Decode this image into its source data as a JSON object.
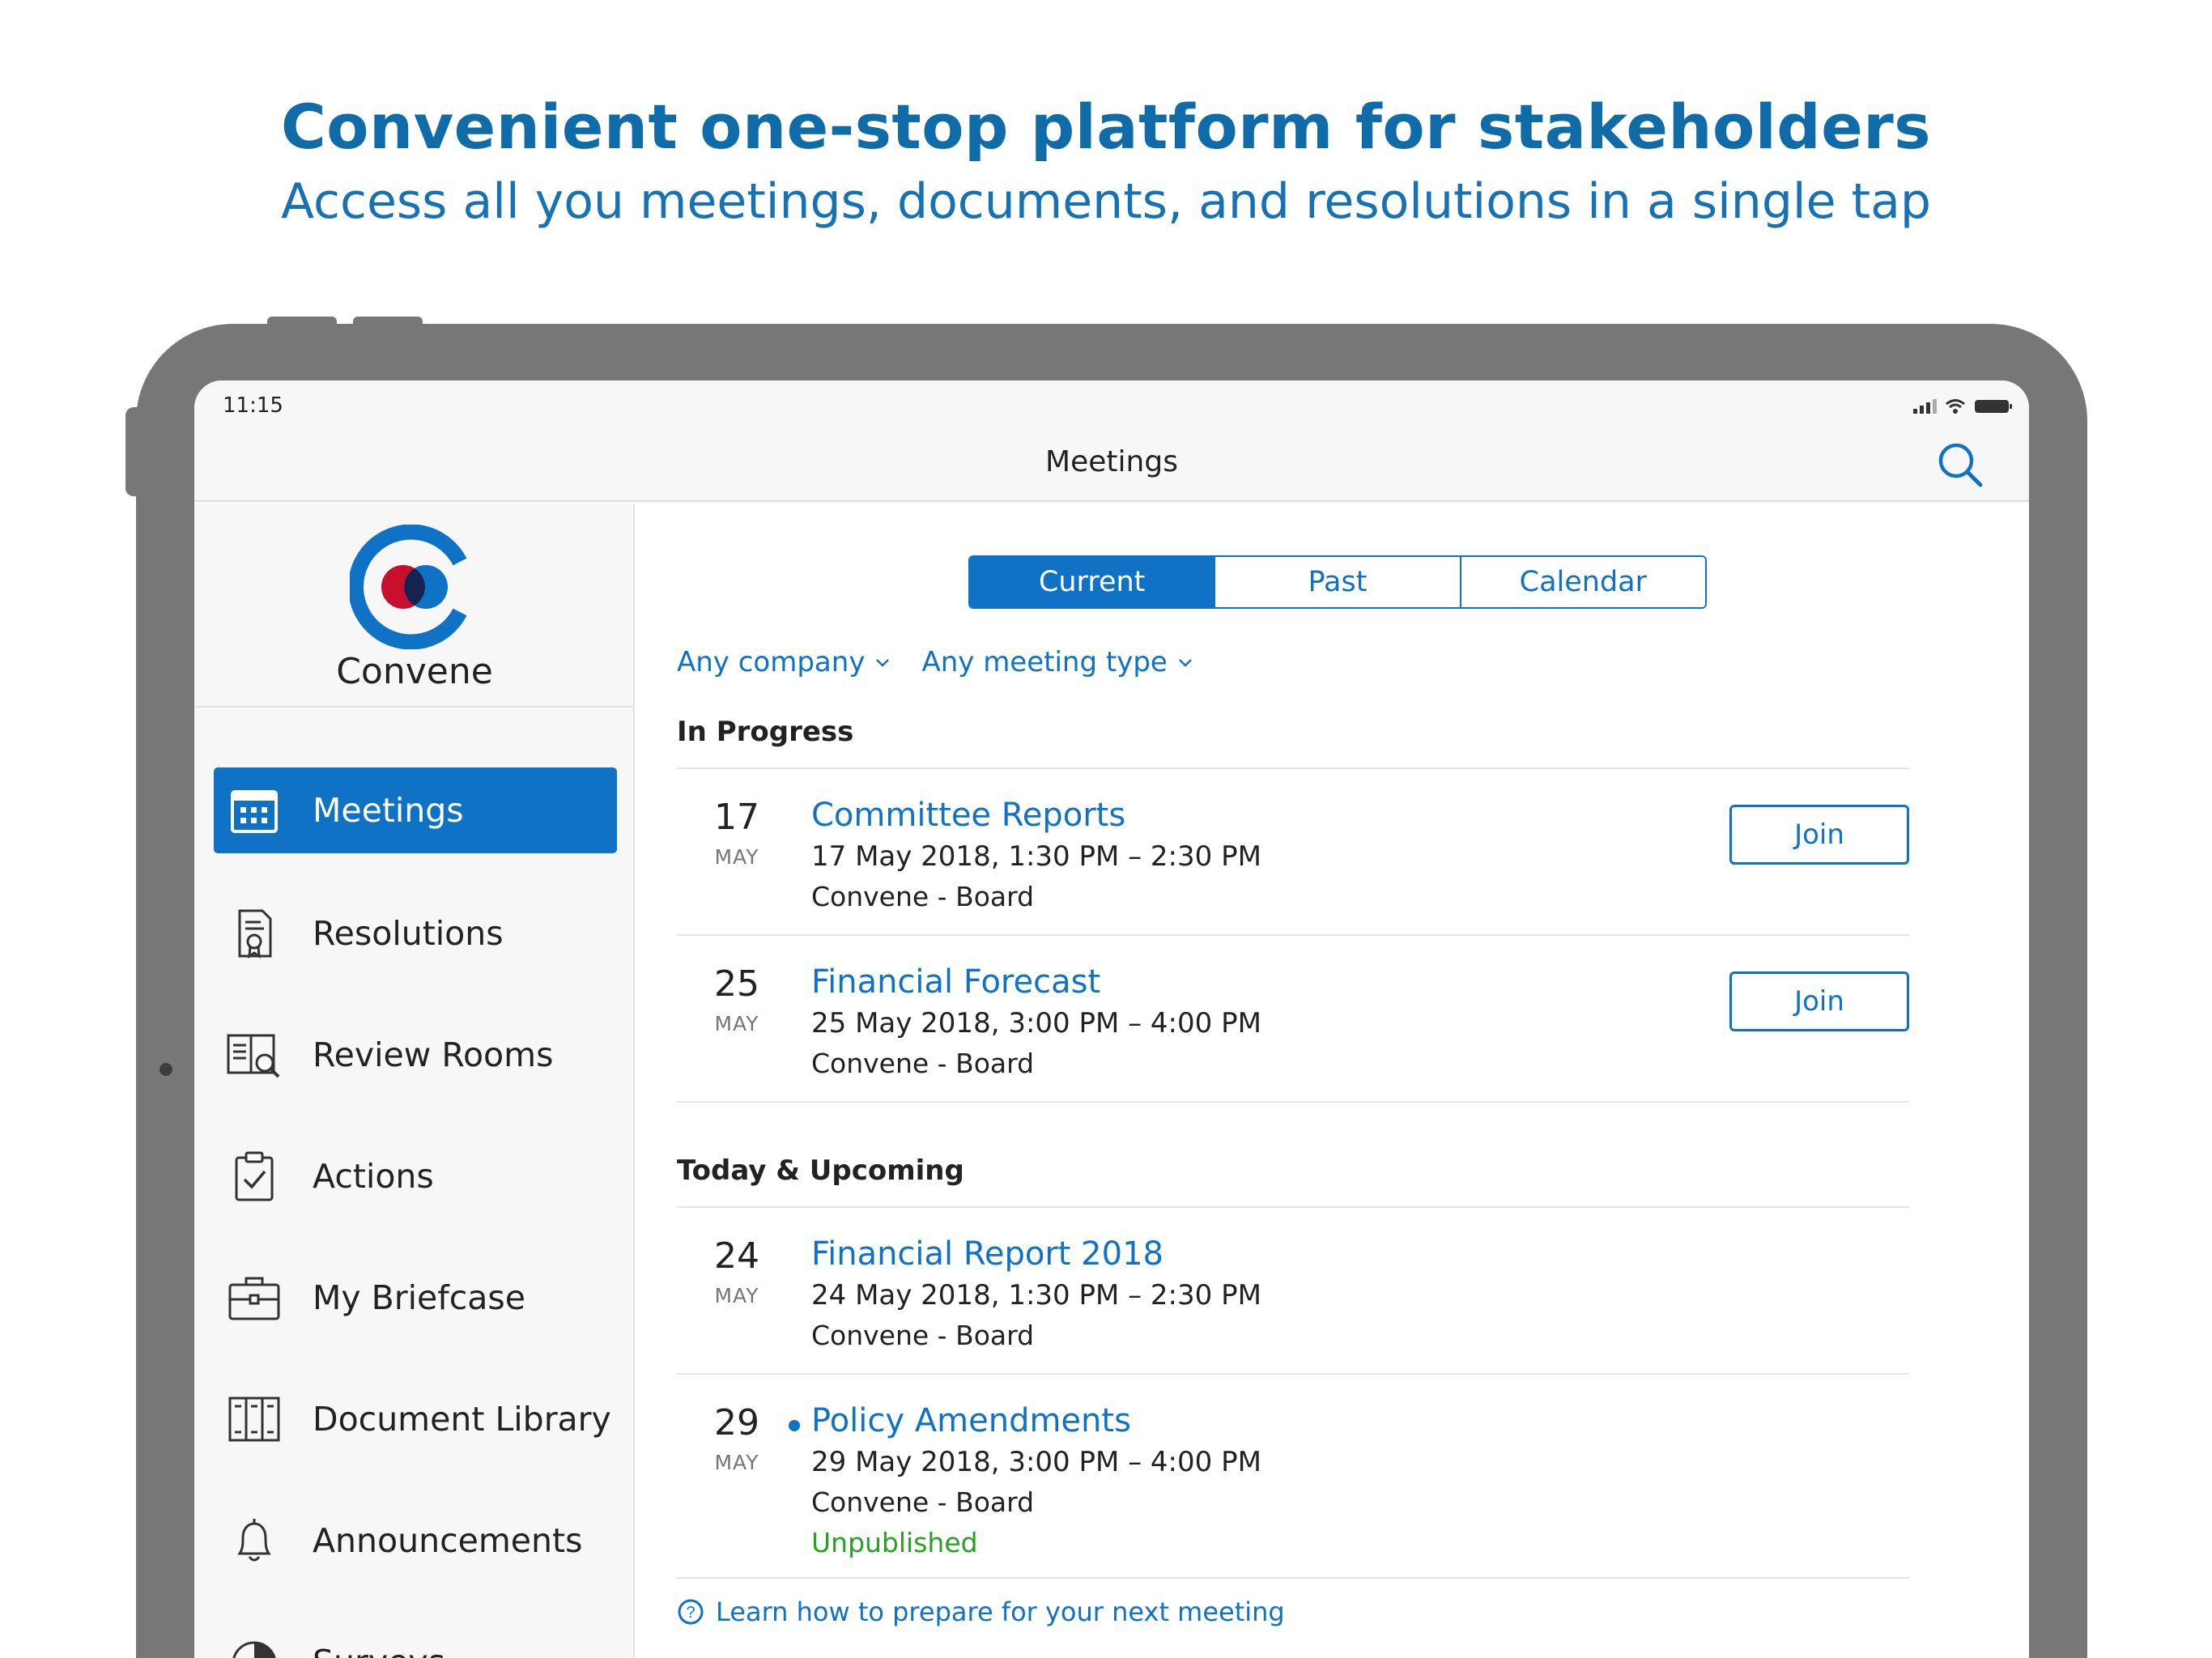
{
  "hero": {
    "title": "Convenient one-stop platform for stakeholders",
    "subtitle": "Access all you meetings, documents, and resolutions in a single tap"
  },
  "status_bar": {
    "time": "11:15"
  },
  "nav_bar": {
    "title": "Meetings",
    "search_icon": "search-icon"
  },
  "sidebar": {
    "brand": "Convene",
    "items": [
      {
        "label": "Meetings",
        "icon": "calendar-icon",
        "active": true
      },
      {
        "label": "Resolutions",
        "icon": "resolution-document-icon",
        "active": false
      },
      {
        "label": "Review Rooms",
        "icon": "review-rooms-icon",
        "active": false
      },
      {
        "label": "Actions",
        "icon": "clipboard-check-icon",
        "active": false
      },
      {
        "label": "My Briefcase",
        "icon": "briefcase-icon",
        "active": false
      },
      {
        "label": "Document Library",
        "icon": "binders-icon",
        "active": false
      },
      {
        "label": "Announcements",
        "icon": "bell-icon",
        "active": false
      },
      {
        "label": "Surveys",
        "icon": "pie-chart-icon",
        "active": false
      }
    ]
  },
  "segments": {
    "current": "Current",
    "past": "Past",
    "calendar": "Calendar",
    "selected": "Current"
  },
  "filters": {
    "company": "Any company",
    "meeting_type": "Any meeting type"
  },
  "in_progress": {
    "heading": "In Progress",
    "meetings": [
      {
        "day": "17",
        "month": "MAY",
        "title": "Committee Reports",
        "time": "17 May 2018, 1:30 PM – 2:30 PM",
        "org": "Convene - Board",
        "action": "Join"
      },
      {
        "day": "25",
        "month": "MAY",
        "title": "Financial Forecast",
        "time": "25 May 2018, 3:00 PM – 4:00 PM",
        "org": "Convene - Board",
        "action": "Join"
      }
    ]
  },
  "upcoming": {
    "heading": "Today & Upcoming",
    "meetings": [
      {
        "day": "24",
        "month": "MAY",
        "title": "Financial Report 2018",
        "time": "24 May 2018, 1:30 PM – 2:30 PM",
        "org": "Convene - Board"
      },
      {
        "day": "29",
        "month": "MAY",
        "title": "Policy Amendments",
        "time": "29 May 2018, 3:00 PM – 4:00 PM",
        "org": "Convene - Board",
        "status": "Unpublished",
        "unread": true
      }
    ]
  },
  "help_link": "Learn how to prepare for your next meeting",
  "colors": {
    "accent": "#0f72c5",
    "hero": "#0f6ca8",
    "published_status": "#28a023",
    "logo_red": "#c8102e",
    "logo_navy": "#16224f"
  }
}
